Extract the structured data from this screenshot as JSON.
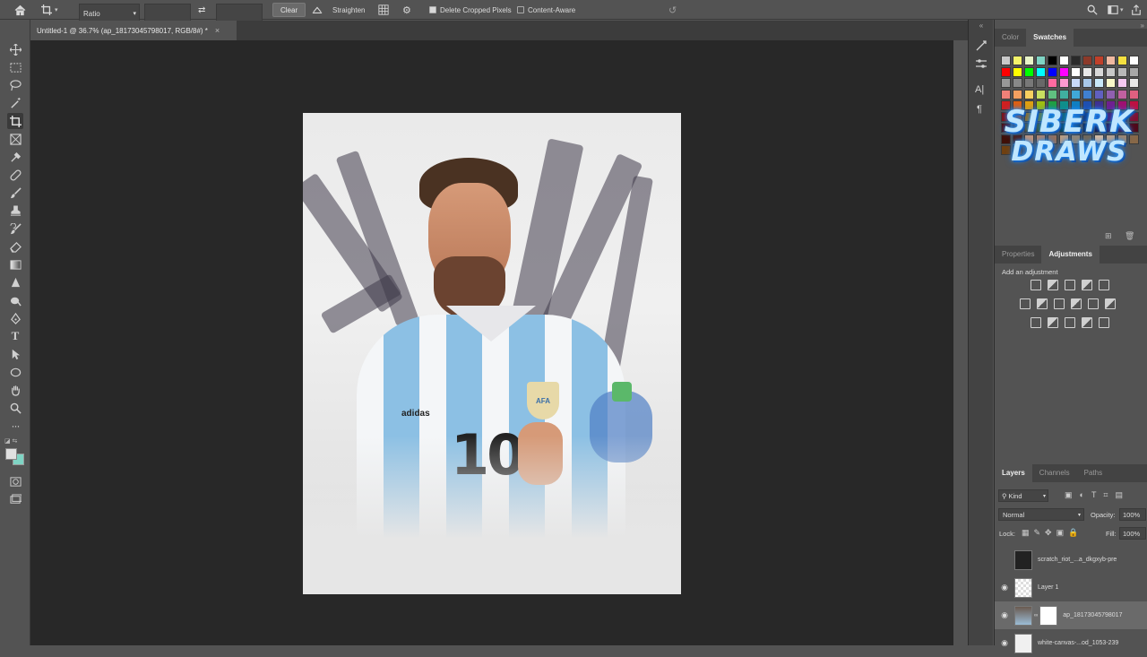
{
  "options_bar": {
    "ratio_label": "Ratio",
    "clear_label": "Clear",
    "straighten_label": "Straighten",
    "delete_cropped_label": "Delete Cropped Pixels",
    "content_aware_label": "Content-Aware",
    "delete_cropped_checked": true,
    "content_aware_checked": false
  },
  "document_tab": {
    "title": "Untitled-1 @ 36.7% (ap_18173045798017, RGB/8#) *",
    "close": "×"
  },
  "canvas": {
    "logo_line1": "SIBERK",
    "logo_line2": "DRAWS",
    "jersey_number": "10",
    "brand": "adidas",
    "crest": "AFA"
  },
  "swatches_panel": {
    "tabs": [
      "Color",
      "Swatches"
    ],
    "active_tab": "Swatches"
  },
  "adjustments_panel": {
    "tabs": [
      "Properties",
      "Adjustments"
    ],
    "active_tab": "Adjustments",
    "hint": "Add an adjustment"
  },
  "layers_panel": {
    "tabs": [
      "Layers",
      "Channels",
      "Paths"
    ],
    "active_tab": "Layers",
    "filter_label": "Kind",
    "blend_mode": "Normal",
    "opacity_label": "Opacity:",
    "opacity_value": "100%",
    "lock_label": "Lock:",
    "fill_label": "Fill:",
    "fill_value": "100%",
    "layers": [
      {
        "name": "scratch_riot_...a_dkgxyb-pre",
        "visible": false
      },
      {
        "name": "Layer 1",
        "visible": true
      },
      {
        "name": "ap_18173045798017",
        "visible": true,
        "selected": true
      },
      {
        "name": "white-canvas-...od_1053-239",
        "visible": true
      }
    ]
  },
  "colors": {
    "ui_bg": "#535353",
    "workspace": "#282828",
    "foreground": "#e0e0e0",
    "background": "#7fd4c4",
    "argentina_blue": "#7fb8e0"
  }
}
